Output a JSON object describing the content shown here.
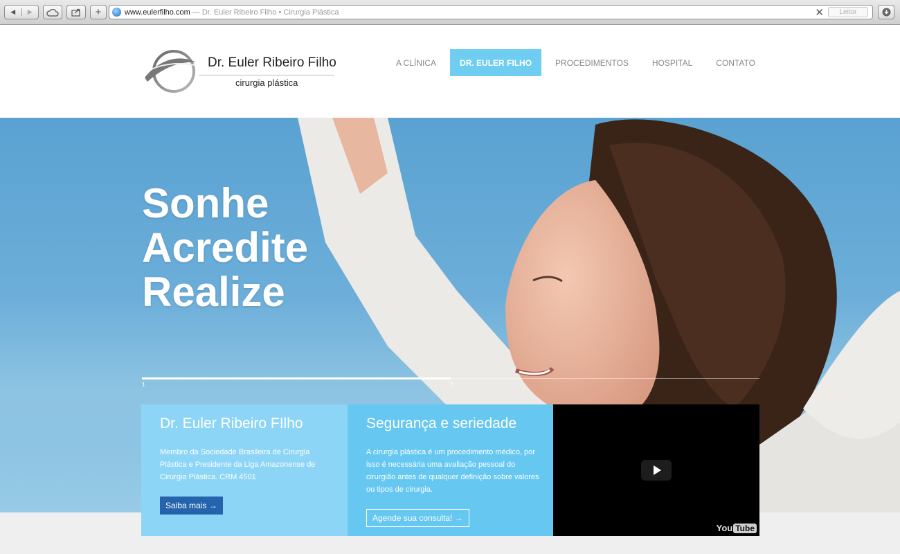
{
  "browser": {
    "url_host": "www.eulerfilho.com",
    "url_title": "— Dr. Euler Ribeiro Filho • Cirurgia Plástica",
    "reader_label": "Leitor",
    "plus_label": "+"
  },
  "logo": {
    "name": "Dr. Euler Ribeiro Filho",
    "subtitle": "cirurgia plástica"
  },
  "nav": {
    "items": [
      "A CLÍNICA",
      "DR. EULER FILHO",
      "PROCEDIMENTOS",
      "HOSPITAL",
      "CONTATO"
    ],
    "active": "DR. EULER FILHO"
  },
  "hero": {
    "lines": [
      "Sonhe",
      "Acredite",
      "Realize"
    ],
    "slides": [
      "1",
      "2"
    ],
    "progress": 0.5
  },
  "panels": [
    {
      "title": "Dr. Euler Ribeiro FIlho",
      "text": "Membro da Sociedade Brasileira de Cirurgia Plástica e Presidente da Liga Amazonense de Cirurgia Plástica. CRM 4501",
      "button": "Saiba mais →"
    },
    {
      "title": "Segurança e seriedade",
      "text": "A cirurgia plástica é um procedimento médico, por isso é necessária uma avaliação pessoal do cirurgião antes de qualquer definição sobre valores ou tipos de cirurgia.",
      "button": "Agende sua consulta! →"
    }
  ],
  "video": {
    "brand_you": "You",
    "brand_tube": "Tube"
  },
  "colors": {
    "accent": "#6fcdf2",
    "panel_light": "#8dd5f7",
    "panel_mid": "#66c7f1",
    "button_blue": "#2563ad",
    "sky": "#6caed9"
  }
}
